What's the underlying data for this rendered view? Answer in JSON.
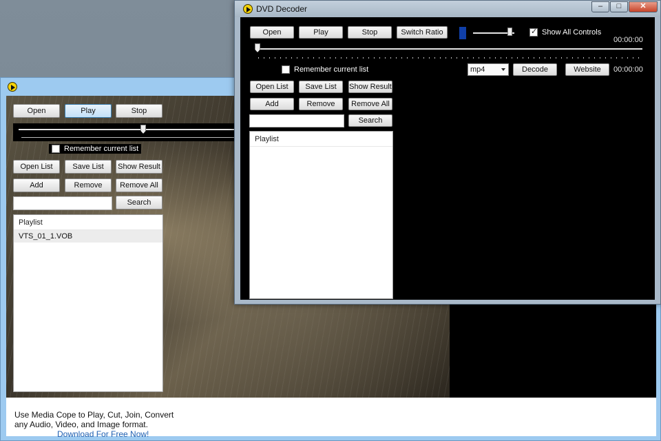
{
  "back_window": {
    "buttons": {
      "open": "Open",
      "play": "Play",
      "stop": "Stop",
      "open_list": "Open List",
      "save_list": "Save List",
      "show_result": "Show Result",
      "add": "Add",
      "remove": "Remove",
      "remove_all": "Remove All",
      "search": "Search"
    },
    "remember_label": "Remember current list",
    "playlist_header": "Playlist",
    "playlist_items": [
      "VTS_01_1.VOB"
    ],
    "ad_text": "Use Media Cope to Play, Cut, Join, Convert any Audio, Video, and Image format.",
    "ad_link": "Download For Free Now!"
  },
  "front_window": {
    "title": "DVD Decoder",
    "window_controls": {
      "minimize": "–",
      "maximize": "□",
      "close": "✕"
    },
    "buttons": {
      "open": "Open",
      "play": "Play",
      "stop": "Stop",
      "switch_ratio": "Switch Ratio",
      "decode": "Decode",
      "website": "Website",
      "open_list": "Open List",
      "save_list": "Save List",
      "show_result": "Show Result",
      "add": "Add",
      "remove": "Remove",
      "remove_all": "Remove All",
      "search": "Search"
    },
    "show_all_controls_label": "Show All Controls",
    "show_all_controls_checked": true,
    "remember_label": "Remember current list",
    "remember_checked": false,
    "time_top": "00:00:00",
    "time_bottom": "00:00:00",
    "format_selected": "mp4",
    "playlist_header": "Playlist",
    "search_value": ""
  },
  "colors": {
    "accent_blue": "#103fa8",
    "logo_yellow": "#f4d20a",
    "ad_link": "#1f5fb0"
  }
}
